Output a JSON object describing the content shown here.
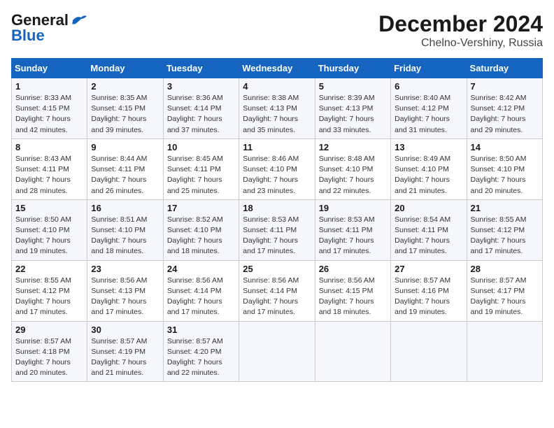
{
  "header": {
    "logo_general": "General",
    "logo_blue": "Blue",
    "month_year": "December 2024",
    "location": "Chelno-Vershiny, Russia"
  },
  "weekdays": [
    "Sunday",
    "Monday",
    "Tuesday",
    "Wednesday",
    "Thursday",
    "Friday",
    "Saturday"
  ],
  "weeks": [
    [
      {
        "day": "1",
        "sunrise": "8:33 AM",
        "sunset": "4:15 PM",
        "daylight": "7 hours and 42 minutes."
      },
      {
        "day": "2",
        "sunrise": "8:35 AM",
        "sunset": "4:15 PM",
        "daylight": "7 hours and 39 minutes."
      },
      {
        "day": "3",
        "sunrise": "8:36 AM",
        "sunset": "4:14 PM",
        "daylight": "7 hours and 37 minutes."
      },
      {
        "day": "4",
        "sunrise": "8:38 AM",
        "sunset": "4:13 PM",
        "daylight": "7 hours and 35 minutes."
      },
      {
        "day": "5",
        "sunrise": "8:39 AM",
        "sunset": "4:13 PM",
        "daylight": "7 hours and 33 minutes."
      },
      {
        "day": "6",
        "sunrise": "8:40 AM",
        "sunset": "4:12 PM",
        "daylight": "7 hours and 31 minutes."
      },
      {
        "day": "7",
        "sunrise": "8:42 AM",
        "sunset": "4:12 PM",
        "daylight": "7 hours and 29 minutes."
      }
    ],
    [
      {
        "day": "8",
        "sunrise": "8:43 AM",
        "sunset": "4:11 PM",
        "daylight": "7 hours and 28 minutes."
      },
      {
        "day": "9",
        "sunrise": "8:44 AM",
        "sunset": "4:11 PM",
        "daylight": "7 hours and 26 minutes."
      },
      {
        "day": "10",
        "sunrise": "8:45 AM",
        "sunset": "4:11 PM",
        "daylight": "7 hours and 25 minutes."
      },
      {
        "day": "11",
        "sunrise": "8:46 AM",
        "sunset": "4:10 PM",
        "daylight": "7 hours and 23 minutes."
      },
      {
        "day": "12",
        "sunrise": "8:48 AM",
        "sunset": "4:10 PM",
        "daylight": "7 hours and 22 minutes."
      },
      {
        "day": "13",
        "sunrise": "8:49 AM",
        "sunset": "4:10 PM",
        "daylight": "7 hours and 21 minutes."
      },
      {
        "day": "14",
        "sunrise": "8:50 AM",
        "sunset": "4:10 PM",
        "daylight": "7 hours and 20 minutes."
      }
    ],
    [
      {
        "day": "15",
        "sunrise": "8:50 AM",
        "sunset": "4:10 PM",
        "daylight": "7 hours and 19 minutes."
      },
      {
        "day": "16",
        "sunrise": "8:51 AM",
        "sunset": "4:10 PM",
        "daylight": "7 hours and 18 minutes."
      },
      {
        "day": "17",
        "sunrise": "8:52 AM",
        "sunset": "4:10 PM",
        "daylight": "7 hours and 18 minutes."
      },
      {
        "day": "18",
        "sunrise": "8:53 AM",
        "sunset": "4:11 PM",
        "daylight": "7 hours and 17 minutes."
      },
      {
        "day": "19",
        "sunrise": "8:53 AM",
        "sunset": "4:11 PM",
        "daylight": "7 hours and 17 minutes."
      },
      {
        "day": "20",
        "sunrise": "8:54 AM",
        "sunset": "4:11 PM",
        "daylight": "7 hours and 17 minutes."
      },
      {
        "day": "21",
        "sunrise": "8:55 AM",
        "sunset": "4:12 PM",
        "daylight": "7 hours and 17 minutes."
      }
    ],
    [
      {
        "day": "22",
        "sunrise": "8:55 AM",
        "sunset": "4:12 PM",
        "daylight": "7 hours and 17 minutes."
      },
      {
        "day": "23",
        "sunrise": "8:56 AM",
        "sunset": "4:13 PM",
        "daylight": "7 hours and 17 minutes."
      },
      {
        "day": "24",
        "sunrise": "8:56 AM",
        "sunset": "4:14 PM",
        "daylight": "7 hours and 17 minutes."
      },
      {
        "day": "25",
        "sunrise": "8:56 AM",
        "sunset": "4:14 PM",
        "daylight": "7 hours and 17 minutes."
      },
      {
        "day": "26",
        "sunrise": "8:56 AM",
        "sunset": "4:15 PM",
        "daylight": "7 hours and 18 minutes."
      },
      {
        "day": "27",
        "sunrise": "8:57 AM",
        "sunset": "4:16 PM",
        "daylight": "7 hours and 19 minutes."
      },
      {
        "day": "28",
        "sunrise": "8:57 AM",
        "sunset": "4:17 PM",
        "daylight": "7 hours and 19 minutes."
      }
    ],
    [
      {
        "day": "29",
        "sunrise": "8:57 AM",
        "sunset": "4:18 PM",
        "daylight": "7 hours and 20 minutes."
      },
      {
        "day": "30",
        "sunrise": "8:57 AM",
        "sunset": "4:19 PM",
        "daylight": "7 hours and 21 minutes."
      },
      {
        "day": "31",
        "sunrise": "8:57 AM",
        "sunset": "4:20 PM",
        "daylight": "7 hours and 22 minutes."
      },
      null,
      null,
      null,
      null
    ]
  ],
  "labels": {
    "sunrise": "Sunrise:",
    "sunset": "Sunset:",
    "daylight": "Daylight:"
  }
}
